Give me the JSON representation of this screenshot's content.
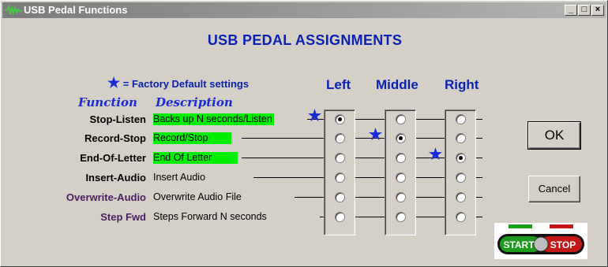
{
  "window": {
    "title": "USB Pedal Functions",
    "minimize": "_",
    "maximize": "□",
    "close": "×"
  },
  "heading": "USB PEDAL ASSIGNMENTS",
  "legend": {
    "star": "★",
    "text": "= Factory Default settings"
  },
  "columns": [
    "Left",
    "Middle",
    "Right"
  ],
  "headers": {
    "function": "Function",
    "description": "Description"
  },
  "rows": [
    {
      "name": "Stop-Listen",
      "description": "Backs up N seconds/Listen",
      "highlight": true,
      "selected": "Left",
      "default": "Left"
    },
    {
      "name": "Record-Stop",
      "description": "Record/Stop",
      "highlight": true,
      "selected": "Middle",
      "default": "Middle"
    },
    {
      "name": "End-Of-Letter",
      "description": "End Of Letter",
      "highlight": true,
      "selected": "Right",
      "default": "Right"
    },
    {
      "name": "Insert-Audio",
      "description": "Insert Audio",
      "highlight": false,
      "selected": null,
      "default": null
    },
    {
      "name": "Overwrite-Audio",
      "description": "Overwrite Audio File",
      "highlight": false,
      "selected": null,
      "default": null
    },
    {
      "name": "Step Fwd",
      "description": "Steps Forward N seconds",
      "highlight": false,
      "selected": null,
      "default": null
    }
  ],
  "buttons": {
    "ok": "OK",
    "cancel": "Cancel"
  },
  "logo": {
    "left_text": "START",
    "right_text": "STOP"
  },
  "colors": {
    "accent": "#0b21b5",
    "highlight": "#00ee00",
    "purple": "#4b1e62"
  }
}
